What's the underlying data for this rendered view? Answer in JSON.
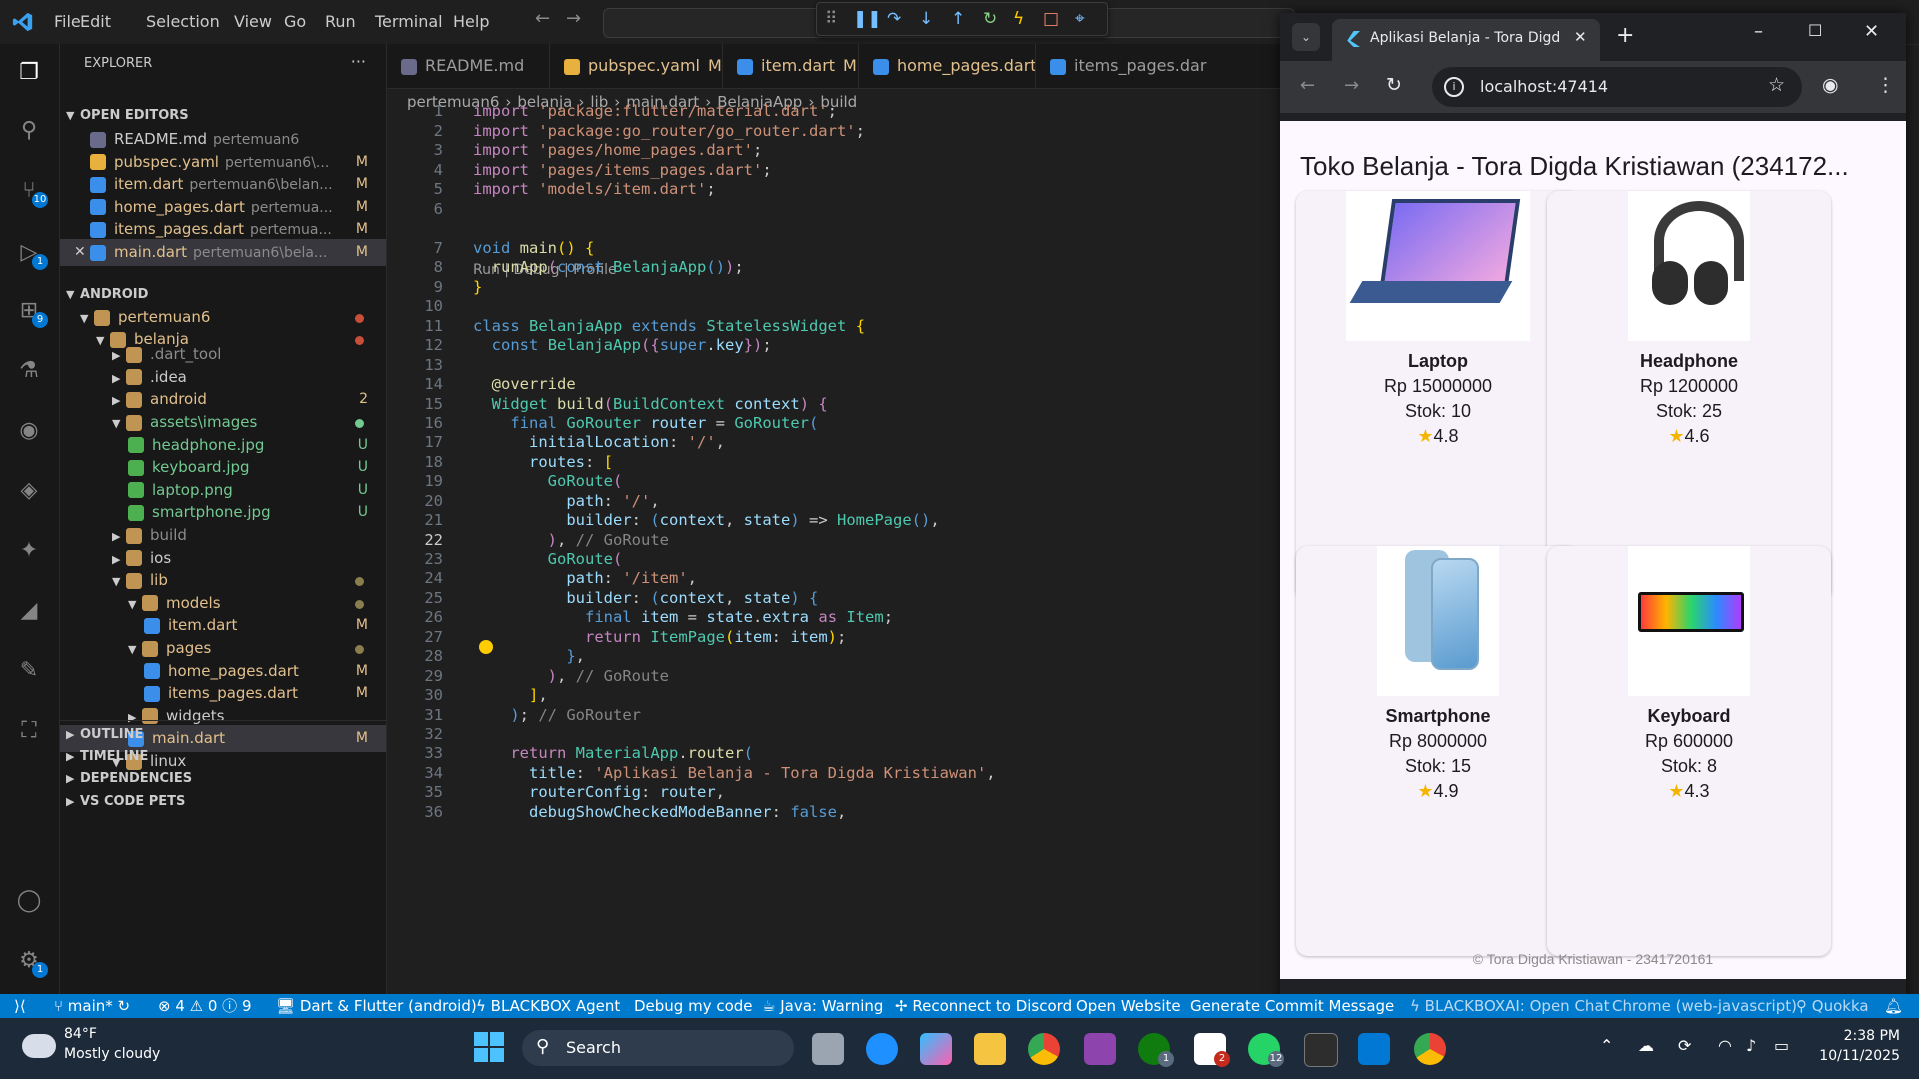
{
  "menu": [
    "File",
    "Edit",
    "Selection",
    "View",
    "Go",
    "Run",
    "Terminal",
    "Help"
  ],
  "sidebar": {
    "title": "EXPLORER",
    "open_editors_label": "OPEN EDITORS",
    "open_editors": [
      {
        "name": "README.md",
        "desc": "pertemuan6",
        "status": "",
        "color": "#6a9cd6"
      },
      {
        "name": "pubspec.yaml",
        "desc": "pertemuan6\\...",
        "status": "M",
        "color": "#e2c08d"
      },
      {
        "name": "item.dart",
        "desc": "pertemuan6\\belan...",
        "status": "M",
        "color": "#e2c08d"
      },
      {
        "name": "home_pages.dart",
        "desc": "pertemua...",
        "status": "M",
        "color": "#e2c08d"
      },
      {
        "name": "items_pages.dart",
        "desc": "pertemua...",
        "status": "M",
        "color": "#e2c08d"
      },
      {
        "name": "main.dart",
        "desc": "pertemuan6\\bela...",
        "status": "M",
        "color": "#e2c08d"
      }
    ],
    "android_label": "ANDROID",
    "tree": [
      {
        "name": "pertemuan6",
        "indent": 1,
        "kind": "folder",
        "open": true,
        "color": "#e2c08d",
        "marker": "dot-red"
      },
      {
        "name": "belanja",
        "indent": 2,
        "kind": "folder",
        "open": true,
        "color": "#e2c08d",
        "marker": "dot-red"
      },
      {
        "name": ".dart_tool",
        "indent": 3,
        "kind": "folder",
        "open": false,
        "color": "#8b8b8b",
        "marker": ""
      },
      {
        "name": ".idea",
        "indent": 3,
        "kind": "folder",
        "open": false,
        "color": "#cccccc",
        "marker": ""
      },
      {
        "name": "android",
        "indent": 3,
        "kind": "folder",
        "open": false,
        "color": "#e2c08d",
        "marker": "2"
      },
      {
        "name": "assets\\images",
        "indent": 3,
        "kind": "folder",
        "open": true,
        "color": "#73c991",
        "marker": "dot-green"
      },
      {
        "name": "headphone.jpg",
        "indent": 4,
        "kind": "file",
        "open": false,
        "color": "#73c991",
        "marker": "U"
      },
      {
        "name": "keyboard.jpg",
        "indent": 4,
        "kind": "file",
        "open": false,
        "color": "#73c991",
        "marker": "U"
      },
      {
        "name": "laptop.png",
        "indent": 4,
        "kind": "file",
        "open": false,
        "color": "#73c991",
        "marker": "U"
      },
      {
        "name": "smartphone.jpg",
        "indent": 4,
        "kind": "file",
        "open": false,
        "color": "#73c991",
        "marker": "U"
      },
      {
        "name": "build",
        "indent": 3,
        "kind": "folder",
        "open": false,
        "color": "#8b8b8b",
        "marker": ""
      },
      {
        "name": "ios",
        "indent": 3,
        "kind": "folder",
        "open": false,
        "color": "#cccccc",
        "marker": ""
      },
      {
        "name": "lib",
        "indent": 3,
        "kind": "folder",
        "open": true,
        "color": "#e2c08d",
        "marker": "dot-yellow"
      },
      {
        "name": "models",
        "indent": 4,
        "kind": "folder",
        "open": true,
        "color": "#e2c08d",
        "marker": "dot-yellow"
      },
      {
        "name": "item.dart",
        "indent": 5,
        "kind": "file",
        "open": false,
        "color": "#e2c08d",
        "marker": "M"
      },
      {
        "name": "pages",
        "indent": 4,
        "kind": "folder",
        "open": true,
        "color": "#e2c08d",
        "marker": "dot-yellow"
      },
      {
        "name": "home_pages.dart",
        "indent": 5,
        "kind": "file",
        "open": false,
        "color": "#e2c08d",
        "marker": "M"
      },
      {
        "name": "items_pages.dart",
        "indent": 5,
        "kind": "file",
        "open": false,
        "color": "#e2c08d",
        "marker": "M"
      },
      {
        "name": "widgets",
        "indent": 4,
        "kind": "folder",
        "open": false,
        "color": "#cccccc",
        "marker": ""
      },
      {
        "name": "main.dart",
        "indent": 4,
        "kind": "file",
        "open": false,
        "color": "#e2c08d",
        "marker": "M"
      },
      {
        "name": "linux",
        "indent": 3,
        "kind": "folder",
        "open": true,
        "color": "#cccccc",
        "marker": ""
      }
    ],
    "bottom_sections": [
      "OUTLINE",
      "TIMELINE",
      "DEPENDENCIES",
      "VS CODE PETS"
    ]
  },
  "tabs": [
    {
      "name": "README.md",
      "status": ""
    },
    {
      "name": "pubspec.yaml",
      "status": "M"
    },
    {
      "name": "item.dart",
      "status": "M"
    },
    {
      "name": "home_pages.dart",
      "status": "M"
    },
    {
      "name": "items_pages.dar",
      "status": ""
    }
  ],
  "breadcrumb": [
    "pertemuan6",
    "belanja",
    "lib",
    "main.dart",
    "BelanjaApp",
    "build"
  ],
  "codelens": "Run | Debug | Profile",
  "activity_badges": {
    "scm": "10",
    "debug": "1",
    "extensions": "9",
    "accounts": "1"
  },
  "browser": {
    "tab_title": "Aplikasi Belanja - Tora Digda Kri",
    "url": "localhost:47414",
    "app_title": "Toko Belanja - Tora Digda Kristiawan (234172...",
    "footer": "© Tora Digda Kristiawan - 2341720161",
    "products": [
      {
        "name": "Laptop",
        "price": "Rp 15000000",
        "stock": "Stok: 10",
        "rating": "4.8",
        "icon": "laptop-image"
      },
      {
        "name": "Headphone",
        "price": "Rp 1200000",
        "stock": "Stok: 25",
        "rating": "4.6",
        "icon": "headphone-image"
      },
      {
        "name": "Smartphone",
        "price": "Rp 8000000",
        "stock": "Stok: 15",
        "rating": "4.9",
        "icon": "smartphone-image"
      },
      {
        "name": "Keyboard",
        "price": "Rp 600000",
        "stock": "Stok: 8",
        "rating": "4.3",
        "icon": "keyboard-image"
      }
    ]
  },
  "statusbar": {
    "branch": "main*",
    "problems": "⊗ 4  ⚠ 0  ⓘ 9",
    "items": [
      "Dart & Flutter (android)",
      "BLACKBOX Agent",
      "Debug my code",
      "Java: Warning",
      "Reconnect to Discord",
      "Open Website",
      "Generate Commit Message",
      "BLACKBOXAI: Open Chat",
      "Chrome (web-javascript)",
      "Quokka"
    ]
  },
  "taskbar": {
    "weather_temp": "84°F",
    "weather_desc": "Mostly cloudy",
    "search": "Search",
    "time": "2:38 PM",
    "date": "10/11/2025",
    "badges": {
      "xbox": "1",
      "notion": "2",
      "whatsapp": "12"
    }
  }
}
